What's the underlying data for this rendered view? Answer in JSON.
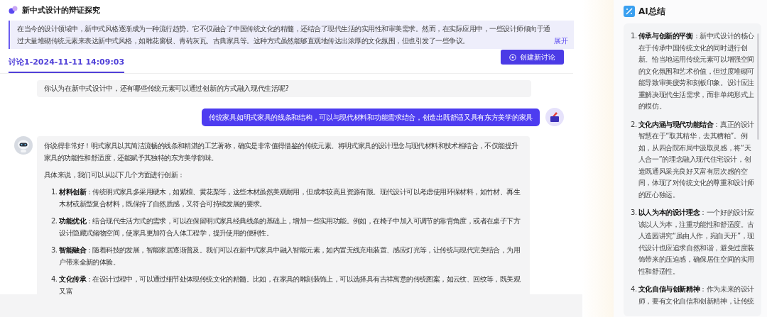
{
  "header": {
    "title": "新中式设计的辩证探究"
  },
  "intro": {
    "text": "在当今的设计领域中，新中式风格逐渐成为一种流行趋势。它不仅融合了中国传统文化的精髓，还结合了现代生活的实用性和审美需求。然而，在实际应用中，一些设计师倾向于通过大量堆砌传统元素来表达新中式风格，如雕花窗棂、青砖灰瓦、古典家具等。这种方式虽然能够直观地传达出浓厚的文化氛围，但也引发了一些争议。",
    "expand": "展开"
  },
  "tabs": [
    {
      "label": "讨论1-2024-11-11 14:09:03",
      "selected": true
    }
  ],
  "create_button": "创建新讨论",
  "messages": [
    {
      "kind": "question",
      "text": "你认为在新中式设计中，还有哪些传统元素可以通过创新的方式融入现代生活呢?"
    },
    {
      "kind": "user",
      "text": "传统家具如明式家具的线条和结构，可以与现代材料和功能需求结合，创造出既舒适又具有东方美学的家具"
    },
    {
      "kind": "ai",
      "paragraphs": [
        "你说得非常好！明式家具以其简洁流畅的线条和精湛的工艺著称，确实是非常值得借鉴的传统元素。将明式家具的设计理念与现代材料和技术相结合，不仅能提升家具的功能性和舒适度，还能赋予其独特的东方美学韵味。",
        "具体来说，我们可以从以下几个方面进行创新："
      ],
      "items": [
        {
          "number": "1.",
          "text": "**材料创新**：传统明式家具多采用硬木，如紫檀、黄花梨等，这些木材虽然美观耐用，但成本较高且资源有限。现代设计可以考虑使用环保材料，如竹材、再生木材或新型复合材料，既保持了自然质感，又符合可持续发展的要求。"
        },
        {
          "number": "2.",
          "text": "**功能优化**：结合现代生活方式的需求，可以在保留明式家具经典线条的基础上，增加一些实用功能。例如，在椅子中加入可调节的靠背角度，或者在桌子下方设计隐藏式储物空间，使家具更加符合人体工程学，提升使用的便利性。"
        },
        {
          "number": "3.",
          "text": "**智能融合**：随着科技的发展，智能家居逐渐普及。我们可以在新中式家具中融入智能元素，如内置无线充电装置、感应灯光等，让传统与现代完美结合，为用户带来全新的体验。"
        },
        {
          "number": "4.",
          "text": "**文化传承**：在设计过程中，可以通过细节处体现传统文化的精髓。比如，在家具的雕刻装饰上，可以选择具有吉祥寓意的传统图案，如云纹、回纹等，既美观又富"
        }
      ]
    }
  ],
  "summary": {
    "title": "AI总结",
    "items": [
      {
        "number": "1.",
        "text": "**传承与创新的平衡**：新中式设计的核心在于传承中国传统文化的同时进行创新。恰当地运用传统元素可以增强空间的文化氛围和艺术价值，但过度堆砌可能导致审美疲劳和刻板印象。设计应注重解决现代生活需求，而非单纯形式上的模仿。"
      },
      {
        "number": "2.",
        "text": "**文化内涵与现代功能结合**：真正的设计智慧在于“取其精华，去其糟粕”。例如，从四合院布局中汲取灵感，将“天人合一”的理念融入现代住宅设计，创造既通风采光良好又富有层次感的空间，体现了对传统文化的尊重和设计师的匠心独运。"
      },
      {
        "number": "3.",
        "text": "**以人为本的设计理念**：一个好的设计应该以人为本，注重功能性和舒适度。古人造园讲究“虽由人作，宛自天开”，现代设计也应追求自然和谐，避免过度装饰带来的压迫感，确保居住空间的实用性和舒适性。"
      },
      {
        "number": "4.",
        "text": "**文化自信与创新精神**：作为未来的设计师，要有文化自信和创新精神，让传统"
      }
    ]
  }
}
